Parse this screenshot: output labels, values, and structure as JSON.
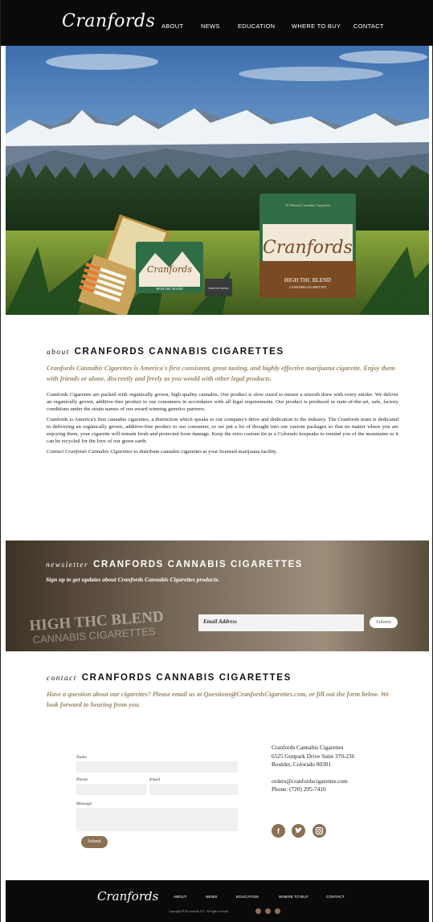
{
  "brand": {
    "logo_text": "Cranfords"
  },
  "nav": [
    "ABOUT",
    "NEWS",
    "EDUCATION",
    "WHERE TO BUY",
    "CONTACT"
  ],
  "hero": {
    "tin_brand": "Cranfords",
    "tin_top_label": "10 Filtered Cannabis Cigarettes",
    "tin_bottom_line1": "HIGH THC BLEND",
    "tin_bottom_line2": "CANNABIS CIGARETTES",
    "small_tin_label": "HIGH THC BLEND",
    "small_pack_label": "HIGH THC BLEND"
  },
  "about": {
    "prefix": "about",
    "title": "CRANFORDS CANNABIS CIGARETTES",
    "lead": "Cranfords Cannabis Cigarettes is America's first consistent, great tasting, and highly effective marijuana cigarette. Enjoy them with friends or alone, discreetly and freely as you would with other legal products.",
    "p1": "Cranfords Cigarettes are packed with organically grown, high quality cannabis. Our product is slow cured to ensure a smooth draw with every smoke. We deliver an organically grown, additive-free product to our consumers in accordance with all legal requirements. Our product is produced in state-of-the-art, safe, factory conditions under the strain names of our award winning genetics partners.",
    "p2": "Cranfords is America's first cannabis cigarettes, a distinction which speaks to our company's drive and dedication to the industry. The Cranfords team is dedicated to delivering an organically grown, additive-free product to our consumer, so we put a lot of thought into our custom packages so that no matter where you are enjoying them, your cigarette will remain fresh and protected from damage. Keep the retro custom tin as a Colorado keepsake to remind you of the mountains or it can be recycled for the love of our green earth.",
    "p3_link": "Contact Cranfords Cannabis Cigarettes",
    "p3_rest": " to distribute cannabis cigarettes at your licensed marijuana facility."
  },
  "newsletter": {
    "prefix": "newsletter",
    "title": "CRANFORDS CANNABIS CIGARETTES",
    "subtitle": "Sign up to get updates about Cranfords Cannabis Cigarettes products.",
    "bg_line1": "HIGH THC BLEND",
    "bg_line2": "CANNABIS CIGARETTES",
    "email_placeholder": "Email Address",
    "submit": "Submit"
  },
  "contact": {
    "prefix": "contact",
    "title": "CRANFORDS CANNABIS CIGARETTES",
    "lead": "Have a question about our cigarettes? Please email us at Questions@CranfordsCigarettes.com, or fill out the form below. We look forward to hearing from you.",
    "labels": {
      "name": "Name",
      "phone": "Phone",
      "email": "Email",
      "message": "Message"
    },
    "submit": "Submit",
    "address_lines": [
      "Cranfords Cannabis Cigarettes",
      "6525 Gunpark Drive Suite 370-236",
      "Boulder, Colorado 80301"
    ],
    "email": "orders@cranfordscigarettes.com",
    "phone": "Phone: (720) 295-7410",
    "social_icons": [
      "facebook-icon",
      "twitter-icon",
      "instagram-icon"
    ]
  },
  "footer": {
    "logo_text": "Cranfords",
    "nav": [
      "ABOUT",
      "NEWS",
      "EDUCATION",
      "WHERE TO BUY",
      "CONTACT"
    ],
    "copyright": "Copyright 2016 Cranfords LLC. All rights reserved."
  },
  "colors": {
    "accent": "#9b8565",
    "button": "#8b7053",
    "header_bg": "#0a0a0a",
    "tin_green": "#2f6d45",
    "tin_brown": "#7a4a22"
  }
}
